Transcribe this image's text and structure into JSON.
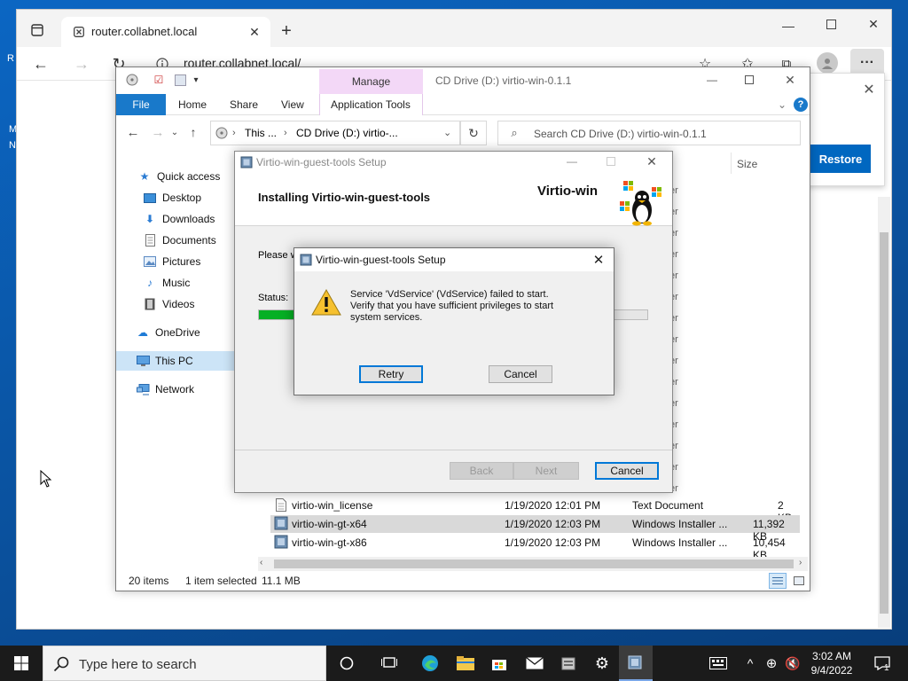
{
  "desktop": {
    "fragments": [
      "R",
      "M",
      "N"
    ]
  },
  "browser": {
    "tab_title": "router.collabnet.local",
    "address": "router.collabnet.local/",
    "popup": {
      "button": "Restore"
    },
    "icons": [
      "tabs-icon",
      "favicon-icon",
      "close-tab-icon",
      "new-tab-icon",
      "back-icon",
      "forward-icon",
      "refresh-icon",
      "info-icon",
      "favorite-add-icon",
      "favorites-icon",
      "collections-icon",
      "profile-icon",
      "more-icon",
      "minimize-icon",
      "maximize-icon",
      "close-icon"
    ]
  },
  "explorer": {
    "title": "CD Drive (D:) virtio-win-0.1.1",
    "manage_label": "Manage",
    "ribbon_tabs": [
      "File",
      "Home",
      "Share",
      "View",
      "Application Tools"
    ],
    "path": [
      "This ...",
      "CD Drive (D:) virtio-..."
    ],
    "search_placeholder": "Search CD Drive (D:) virtio-win-0.1.1",
    "column_size": "Size",
    "sidebar": [
      {
        "label": "Quick access",
        "icon": "star-icon"
      },
      {
        "label": "Desktop",
        "icon": "desktop-icon"
      },
      {
        "label": "Downloads",
        "icon": "download-icon"
      },
      {
        "label": "Documents",
        "icon": "documents-icon"
      },
      {
        "label": "Pictures",
        "icon": "pictures-icon"
      },
      {
        "label": "Music",
        "icon": "music-icon"
      },
      {
        "label": "Videos",
        "icon": "videos-icon"
      },
      {
        "label": "OneDrive",
        "icon": "cloud-icon"
      },
      {
        "label": "This PC",
        "icon": "computer-icon"
      },
      {
        "label": "Network",
        "icon": "network-icon"
      }
    ],
    "partial_type_fragment": "er",
    "files": [
      {
        "name": "virtio-win_license",
        "date": "1/19/2020 12:01 PM",
        "type": "Text Document",
        "size": "2 KB",
        "selected": false
      },
      {
        "name": "virtio-win-gt-x64",
        "date": "1/19/2020 12:03 PM",
        "type": "Windows Installer ...",
        "size": "11,392 KB",
        "selected": true
      },
      {
        "name": "virtio-win-gt-x86",
        "date": "1/19/2020 12:03 PM",
        "type": "Windows Installer ...",
        "size": "10,454 KB",
        "selected": false
      }
    ],
    "status": {
      "items": "20 items",
      "selected": "1 item selected",
      "size": "11.1 MB"
    }
  },
  "setup": {
    "title": "Virtio-win-guest-tools Setup",
    "heading": "Installing Virtio-win-guest-tools",
    "brand": "Virtio-win",
    "please_wait": "Please w",
    "status_label": "Status:",
    "progress": 0.1,
    "buttons": {
      "back": "Back",
      "next": "Next",
      "cancel": "Cancel"
    }
  },
  "error_dialog": {
    "title": "Virtio-win-guest-tools Setup",
    "message": "Service 'VdService' (VdService) failed to start.  Verify that you have sufficient privileges to start system services.",
    "retry": "Retry",
    "cancel": "Cancel"
  },
  "taskbar": {
    "search_placeholder": "Type here to search",
    "time": "3:02 AM",
    "date": "9/4/2022",
    "notification_count": "1"
  }
}
